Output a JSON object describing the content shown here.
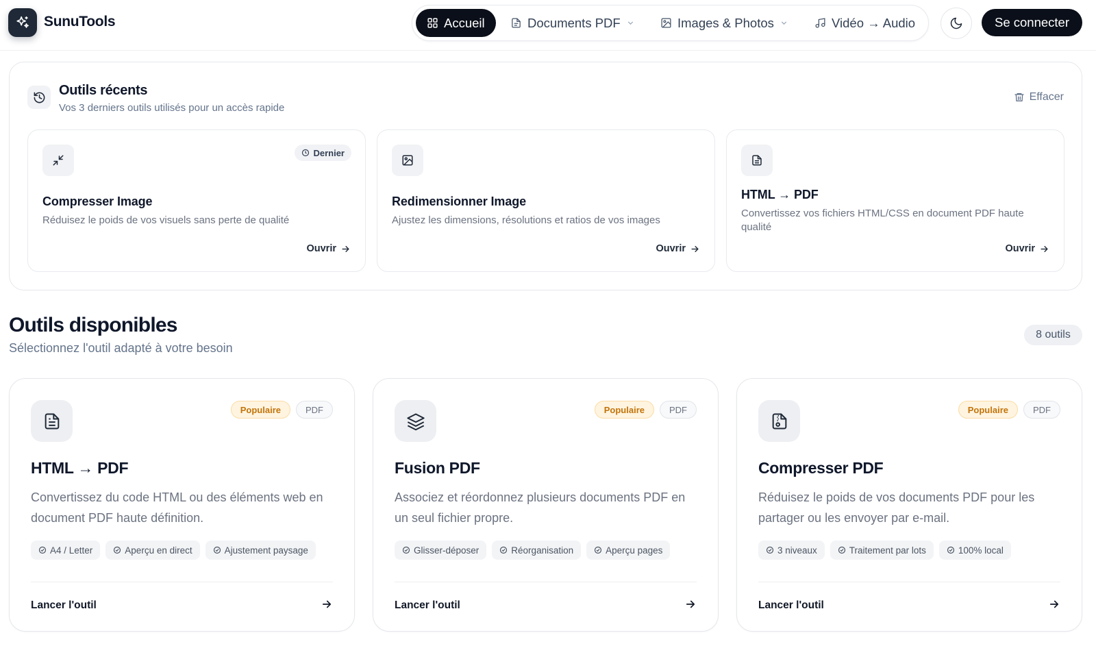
{
  "brand": {
    "name": "SunuTools"
  },
  "nav": {
    "items": [
      {
        "label": "Accueil",
        "active": true
      },
      {
        "label": "Documents PDF",
        "dropdown": true
      },
      {
        "label": "Images & Photos",
        "dropdown": true
      },
      {
        "label": "Vidéo → Audio"
      }
    ],
    "login_label": "Se connecter"
  },
  "recent": {
    "title": "Outils récents",
    "subtitle": "Vos 3 derniers outils utilisés pour un accès rapide",
    "clear_label": "Effacer",
    "cards": [
      {
        "icon": "minimize-icon",
        "badge": "Dernier",
        "title": "Compresser Image",
        "desc": "Réduisez le poids de vos visuels sans perte de qualité",
        "open": "Ouvrir"
      },
      {
        "icon": "image-icon",
        "title": "Redimensionner Image",
        "desc": "Ajustez les dimensions, résolutions et ratios de vos images",
        "open": "Ouvrir"
      },
      {
        "icon": "file-text-icon",
        "title": "HTML → PDF",
        "desc": "Convertissez vos fichiers HTML/CSS en document PDF haute qualité",
        "open": "Ouvrir"
      }
    ]
  },
  "tools": {
    "title": "Outils disponibles",
    "subtitle": "Sélectionnez l'outil adapté à votre besoin",
    "count": "8 outils",
    "cards": [
      {
        "icon": "file-text-icon",
        "badges": [
          "Populaire",
          "PDF"
        ],
        "title": "HTML → PDF",
        "desc": "Convertissez du code HTML ou des éléments web en document PDF haute définition.",
        "tags": [
          "A4 / Letter",
          "Aperçu en direct",
          "Ajustement paysage"
        ],
        "launch": "Lancer l'outil"
      },
      {
        "icon": "layers-icon",
        "badges": [
          "Populaire",
          "PDF"
        ],
        "title": "Fusion PDF",
        "desc": "Associez et réordonnez plusieurs documents PDF en un seul fichier propre.",
        "tags": [
          "Glisser-déposer",
          "Réorganisation",
          "Aperçu pages"
        ],
        "launch": "Lancer l'outil"
      },
      {
        "icon": "file-archive-icon",
        "badges": [
          "Populaire",
          "PDF"
        ],
        "title": "Compresser PDF",
        "desc": "Réduisez le poids de vos documents PDF pour les partager ou les envoyer par e-mail.",
        "tags": [
          "3 niveaux",
          "Traitement par lots",
          "100% local"
        ],
        "launch": "Lancer l'outil"
      }
    ]
  },
  "colors": {
    "primary": "#0b0f19",
    "popular_text": "#c2740b",
    "popular_bg": "#fff4e0",
    "muted": "#64748b"
  }
}
